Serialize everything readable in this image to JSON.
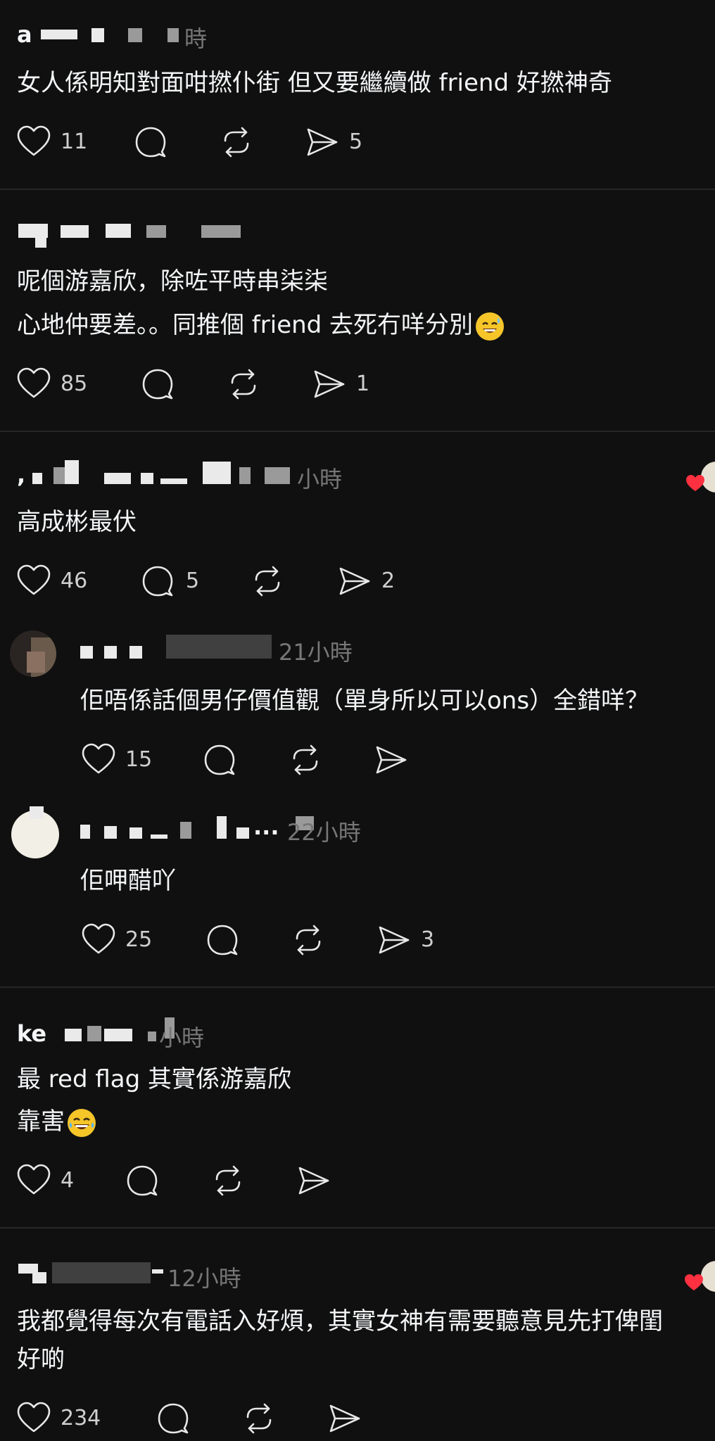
{
  "posts": [
    {
      "name": "a",
      "time": "時",
      "lines": [
        "女人係明知對面咁撚仆街 但又要繼續做 friend 好撚神奇"
      ],
      "likes": "11",
      "replies": "",
      "reposts": "",
      "shares": "5"
    },
    {
      "name": "",
      "time": "",
      "lines": [
        "呢個游嘉欣，除咗平時串柒柒",
        "心地仲要差。。同推個 friend 去死冇咩分別"
      ],
      "emoji": "😅",
      "likes": "85",
      "replies": "",
      "reposts": "",
      "shares": "1"
    },
    {
      "name": ",",
      "time": "小時",
      "lines": [
        "高成彬最伏"
      ],
      "likes": "46",
      "replies": "5",
      "reposts": "",
      "shares": "2"
    },
    {
      "name": "",
      "time": "21小時",
      "lines": [
        "佢唔係話個男仔價值觀（單身所以可以ons）全錯咩？"
      ],
      "likes": "15",
      "replies": "",
      "reposts": "",
      "shares": ""
    },
    {
      "name": "...",
      "time": "22小時",
      "lines": [
        "佢呷醋吖"
      ],
      "likes": "25",
      "replies": "",
      "reposts": "",
      "shares": "3"
    },
    {
      "name": "ke",
      "time": "小時",
      "lines": [
        "最 red flag 其實係游嘉欣",
        "靠害"
      ],
      "emoji": "😂",
      "likes": "4",
      "replies": "",
      "reposts": "",
      "shares": ""
    },
    {
      "name": "",
      "time": "12小時",
      "lines": [
        "我都覺得每次有電話入好煩，其實女神有需要聽意見先打俾閨",
        "好啲"
      ],
      "likes": "234",
      "replies": "",
      "reposts": "",
      "shares": ""
    }
  ],
  "icons": {
    "like": "heart-icon",
    "reply": "comment-icon",
    "repost": "repost-icon",
    "share": "share-icon"
  },
  "colors": {
    "background": "#101010",
    "text": "#f3f5f7",
    "meta": "#777777",
    "separator": "#262626",
    "heart_badge": "#ff3040"
  }
}
